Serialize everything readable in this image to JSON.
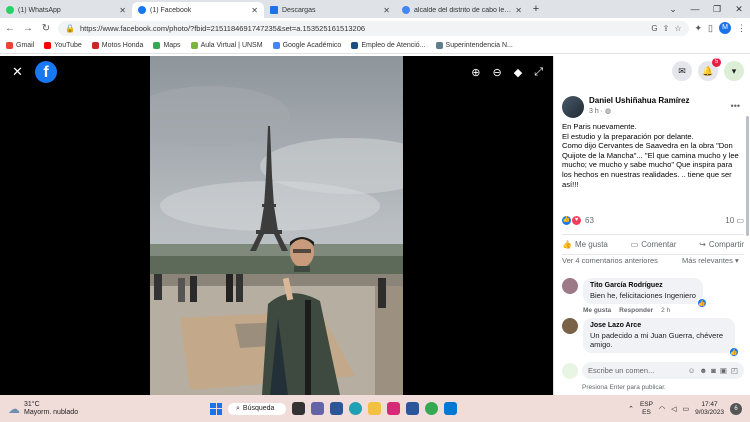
{
  "browser": {
    "tabs": [
      {
        "title": "(1) WhatsApp",
        "color": "#25d366",
        "active": false
      },
      {
        "title": "(1) Facebook",
        "color": "#1877f2",
        "active": true
      },
      {
        "title": "Descargas",
        "color": "#1a73e8",
        "active": false
      },
      {
        "title": "alcalde del distrito de cabo leva…",
        "color": "#4285f4",
        "active": false
      }
    ],
    "new_tab": "+",
    "url": "https://www.facebook.com/photo/?fbid=2151184691747235&set=a.153525161513206",
    "profile_initial": "M",
    "bookmarks": [
      {
        "label": "Gmail",
        "color": "#ea4335"
      },
      {
        "label": "YouTube",
        "color": "#ff0000"
      },
      {
        "label": "Motos Honda",
        "color": "#c62828"
      },
      {
        "label": "Maps",
        "color": "#34a853"
      },
      {
        "label": "Aula Virtual | UNSM",
        "color": "#7cb342"
      },
      {
        "label": "Google Académico",
        "color": "#4285f4"
      },
      {
        "label": "Empleo de Atenció...",
        "color": "#1c4e80"
      },
      {
        "label": "Superintendencia N...",
        "color": "#607d8b"
      }
    ]
  },
  "post": {
    "author": "Daniel Ushiñahua Ramírez",
    "time": "3 h ·",
    "text_lines": [
      "En Paris nuevamente.",
      "El estudio y la preparación por delante.",
      "Como dijo Cervantes de Saavedra en la obra \"Don Quijote de la Mancha\"... \"El que camina mucho y lee mucho; ve mucho y sabe mucho\" Que inspira para los hechos en nuestras realidades. .. tiene que ser así!!!"
    ],
    "reaction_count": "63",
    "comment_count": "10",
    "actions": {
      "like": "Me gusta",
      "comment": "Comentar",
      "share": "Compartir"
    },
    "more_comments": "Ver 4 comentarios anteriores",
    "sort": "Más relevantes",
    "notification_badge": "5"
  },
  "comments": [
    {
      "name": "Tito García Rodríguez",
      "text": "Bien he, felicitaciones Ingeniero",
      "like": "Me gusta",
      "reply": "Responder",
      "time": "2 h"
    },
    {
      "name": "Jose Lazo Arce",
      "text": "Un padecido a mi Juan Guerra, chévere amigo.",
      "like": "",
      "reply": "",
      "time": ""
    }
  ],
  "compose": {
    "placeholder": "Escribe un comen...",
    "hint": "Presiona Enter para publicar."
  },
  "taskbar": {
    "temp": "31°C",
    "weather": "Mayorm. nublado",
    "search": "Búsqueda",
    "lang1": "ESP",
    "lang2": "ES",
    "time": "17:47",
    "date": "9/03/2023",
    "notif": "6"
  }
}
